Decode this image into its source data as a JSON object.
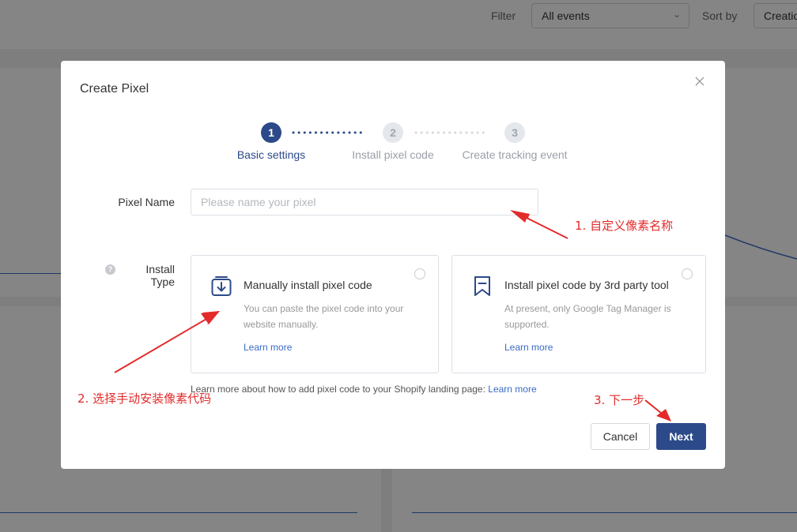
{
  "background": {
    "filter_label": "Filter",
    "filter_value": "All events",
    "sort_label": "Sort by",
    "sort_value": "Creation"
  },
  "modal": {
    "title": "Create Pixel",
    "steps": [
      {
        "number": "1",
        "label": "Basic settings",
        "state": "active"
      },
      {
        "number": "2",
        "label": "Install pixel code",
        "state": "inactive"
      },
      {
        "number": "3",
        "label": "Create tracking event",
        "state": "inactive"
      }
    ],
    "pixel_name": {
      "label": "Pixel Name",
      "placeholder": "Please name your pixel",
      "value": ""
    },
    "install_type": {
      "label": "Install Type",
      "help_icon": "?",
      "options": [
        {
          "icon": "download-box-icon",
          "title": "Manually install pixel code",
          "description": "You can paste the pixel code into your website manually.",
          "link": "Learn more"
        },
        {
          "icon": "bookmark-icon",
          "title": "Install pixel code by 3rd party tool",
          "description": "At present, only Google Tag Manager is supported.",
          "link": "Learn more"
        }
      ]
    },
    "learn_more_text": "Learn more about how to add pixel code to your Shopify landing page: ",
    "learn_more_link": "Learn more",
    "buttons": {
      "cancel": "Cancel",
      "next": "Next"
    }
  },
  "annotations": {
    "step1": "1. 自定义像素名称",
    "step2": "2. 选择手动安装像素代码",
    "step3": "3. 下一步",
    "color": "#e32b2b"
  },
  "colors": {
    "primary": "#2c4a89",
    "link": "#3a6bc4",
    "annotation": "#e32b2b"
  }
}
